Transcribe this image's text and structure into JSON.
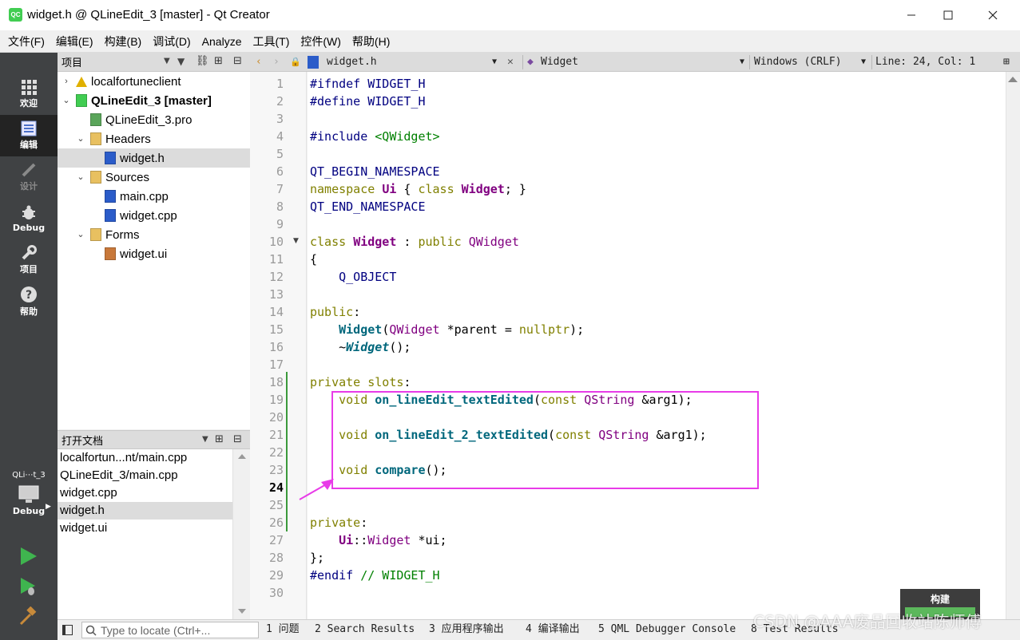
{
  "window": {
    "app_icon_text": "QC",
    "title": "widget.h @ QLineEdit_3 [master] - Qt Creator"
  },
  "menu": [
    "文件(F)",
    "编辑(E)",
    "构建(B)",
    "调试(D)",
    "Analyze",
    "工具(T)",
    "控件(W)",
    "帮助(H)"
  ],
  "modes": {
    "welcome": "欢迎",
    "edit": "编辑",
    "design": "设计",
    "debug": "Debug",
    "projects": "项目",
    "help": "帮助",
    "kit_name": "QLi⋯t_3",
    "kit_mode": "Debug"
  },
  "project_pane": {
    "title": "项目",
    "tree": [
      {
        "label": "localfortuneclient",
        "depth": 0,
        "icon": "warning-icon",
        "arrow": "collapsed"
      },
      {
        "label": "QLineEdit_3 [master]",
        "depth": 0,
        "icon": "project-icon",
        "arrow": "expanded",
        "bold": true
      },
      {
        "label": "QLineEdit_3.pro",
        "depth": 1,
        "icon": "pro-file-icon",
        "arrow": "none"
      },
      {
        "label": "Headers",
        "depth": 1,
        "icon": "headers-folder-icon",
        "arrow": "expanded"
      },
      {
        "label": "widget.h",
        "depth": 2,
        "icon": "header-file-icon",
        "arrow": "none",
        "selected": true
      },
      {
        "label": "Sources",
        "depth": 1,
        "icon": "sources-folder-icon",
        "arrow": "expanded"
      },
      {
        "label": "main.cpp",
        "depth": 2,
        "icon": "cpp-file-icon",
        "arrow": "none"
      },
      {
        "label": "widget.cpp",
        "depth": 2,
        "icon": "cpp-file-icon",
        "arrow": "none"
      },
      {
        "label": "Forms",
        "depth": 1,
        "icon": "forms-folder-icon",
        "arrow": "expanded"
      },
      {
        "label": "widget.ui",
        "depth": 2,
        "icon": "ui-file-icon",
        "arrow": "none"
      }
    ]
  },
  "open_documents": {
    "title": "打开文档",
    "items": [
      {
        "label": "localfortun...nt/main.cpp"
      },
      {
        "label": "QLineEdit_3/main.cpp"
      },
      {
        "label": "widget.cpp"
      },
      {
        "label": "widget.h",
        "selected": true
      },
      {
        "label": "widget.ui"
      }
    ]
  },
  "editor_toolbar": {
    "file_name": "widget.h",
    "symbol": "Widget",
    "line_ending": "Windows (CRLF)",
    "position": "Line: 24, Col: 1"
  },
  "editor": {
    "current_line": 24,
    "lines": [
      {
        "n": "1",
        "tokens": [
          [
            "pp",
            "#ifndef WIDGET_H"
          ]
        ]
      },
      {
        "n": "2",
        "tokens": [
          [
            "pp",
            "#define WIDGET_H"
          ]
        ]
      },
      {
        "n": "3",
        "tokens": []
      },
      {
        "n": "4",
        "tokens": [
          [
            "pp",
            "#include "
          ],
          [
            "inc",
            "<QWidget>"
          ]
        ]
      },
      {
        "n": "5",
        "tokens": []
      },
      {
        "n": "6",
        "tokens": [
          [
            "pp",
            "QT_BEGIN_NAMESPACE"
          ]
        ]
      },
      {
        "n": "7",
        "tokens": [
          [
            "kw",
            "namespace "
          ],
          [
            "cls",
            "Ui"
          ],
          [
            "",
            " { "
          ],
          [
            "kw",
            "class "
          ],
          [
            "cls",
            "Widget"
          ],
          [
            "",
            "; }"
          ]
        ]
      },
      {
        "n": "8",
        "tokens": [
          [
            "pp",
            "QT_END_NAMESPACE"
          ]
        ]
      },
      {
        "n": "9",
        "tokens": []
      },
      {
        "n": "10",
        "tokens": [
          [
            "kw",
            "class "
          ],
          [
            "cls",
            "Widget"
          ],
          [
            "",
            " : "
          ],
          [
            "kw",
            "public "
          ],
          [
            "ty",
            "QWidget"
          ]
        ]
      },
      {
        "n": "11",
        "tokens": [
          [
            "",
            "{"
          ]
        ]
      },
      {
        "n": "12",
        "tokens": [
          [
            "",
            "    "
          ],
          [
            "pp",
            "Q_OBJECT"
          ]
        ]
      },
      {
        "n": "13",
        "tokens": []
      },
      {
        "n": "14",
        "tokens": [
          [
            "kw",
            "public"
          ],
          [
            "",
            ":"
          ]
        ]
      },
      {
        "n": "15",
        "tokens": [
          [
            "",
            "    "
          ],
          [
            "fn",
            "Widget"
          ],
          [
            "",
            "("
          ],
          [
            "ty",
            "QWidget"
          ],
          [
            "",
            " *parent = "
          ],
          [
            "kw",
            "nullptr"
          ],
          [
            "",
            ");"
          ]
        ]
      },
      {
        "n": "16",
        "tokens": [
          [
            "",
            "    ~"
          ],
          [
            "fni",
            "Widget"
          ],
          [
            "",
            "();"
          ]
        ]
      },
      {
        "n": "17",
        "tokens": []
      },
      {
        "n": "18",
        "tokens": [
          [
            "kw",
            "private slots"
          ],
          [
            "",
            ":"
          ]
        ]
      },
      {
        "n": "19",
        "tokens": [
          [
            "",
            "    "
          ],
          [
            "kw",
            "void "
          ],
          [
            "fn",
            "on_lineEdit_textEdited"
          ],
          [
            "",
            "("
          ],
          [
            "kw",
            "const "
          ],
          [
            "ty",
            "QString"
          ],
          [
            "",
            " &arg1);"
          ]
        ]
      },
      {
        "n": "20",
        "tokens": []
      },
      {
        "n": "21",
        "tokens": [
          [
            "",
            "    "
          ],
          [
            "kw",
            "void "
          ],
          [
            "fn",
            "on_lineEdit_2_textEdited"
          ],
          [
            "",
            "("
          ],
          [
            "kw",
            "const "
          ],
          [
            "ty",
            "QString"
          ],
          [
            "",
            " &arg1);"
          ]
        ]
      },
      {
        "n": "22",
        "tokens": []
      },
      {
        "n": "23",
        "tokens": [
          [
            "",
            "    "
          ],
          [
            "kw",
            "void "
          ],
          [
            "fn",
            "compare"
          ],
          [
            "",
            "();"
          ]
        ]
      },
      {
        "n": "24",
        "tokens": []
      },
      {
        "n": "25",
        "tokens": []
      },
      {
        "n": "26",
        "tokens": [
          [
            "kw",
            "private"
          ],
          [
            "",
            ":"
          ]
        ]
      },
      {
        "n": "27",
        "tokens": [
          [
            "",
            "    "
          ],
          [
            "cls",
            "Ui"
          ],
          [
            "",
            "::"
          ],
          [
            "ty",
            "Widget"
          ],
          [
            "",
            " *ui;"
          ]
        ]
      },
      {
        "n": "28",
        "tokens": [
          [
            "",
            "};"
          ]
        ]
      },
      {
        "n": "29",
        "tokens": [
          [
            "pp",
            "#endif "
          ],
          [
            "cm",
            "// WIDGET_H"
          ]
        ]
      },
      {
        "n": "30",
        "tokens": []
      }
    ]
  },
  "build_popup": {
    "label": "构建"
  },
  "statusbar": {
    "locator_placeholder": "Type to locate (Ctrl+...",
    "tabs": [
      "1 问题",
      "2 Search Results",
      "3 应用程序输出",
      "4 编译输出",
      "5 QML Debugger Console",
      "8 Test Results"
    ]
  },
  "watermark": "CSDN @AAA废品回收站陈师傅",
  "colors": {
    "annotation": "#e83be8",
    "modebar": "#404244",
    "keyword": "#808000",
    "type": "#800080",
    "function": "#00677c"
  }
}
